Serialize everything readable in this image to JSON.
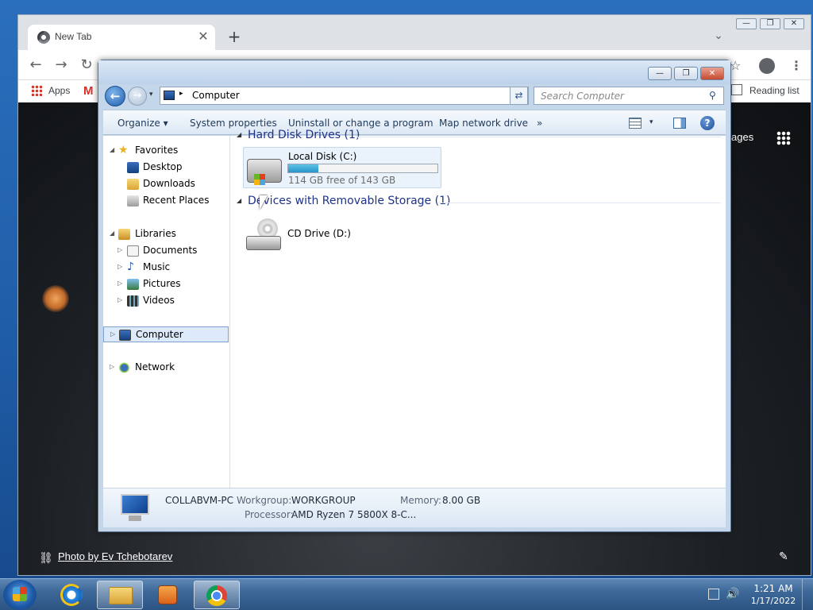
{
  "desktop": {
    "background_color": "#1f5ca6"
  },
  "chrome": {
    "tab_title": "New Tab",
    "tab_close": "✕",
    "new_tab": "+",
    "tab_dropdown": "⌄",
    "win_minimize": "—",
    "win_restore": "❐",
    "win_close": "✕",
    "nav_back": "←",
    "nav_forward": "→",
    "nav_reload": "↻",
    "star": "☆",
    "menu": "⋮",
    "bookmarks": {
      "apps_label": "Apps",
      "gmail": "M",
      "reading_list": "Reading list"
    },
    "ntp": {
      "images_link": "ages",
      "photo_credit": "Photo by Ev Tchebotarev",
      "link_icon": "⛓",
      "edit_icon": "✎"
    }
  },
  "explorer": {
    "win_minimize": "—",
    "win_restore": "❐",
    "win_close": "✕",
    "back": "←",
    "forward": "→",
    "recent_dd": "▾",
    "address": {
      "arrow": "▸",
      "path": "Computer",
      "dropdown": "▾",
      "refresh": "⇄"
    },
    "search": {
      "placeholder": "Search Computer",
      "icon": "⚲"
    },
    "commands": {
      "organize": "Organize ▾",
      "system_properties": "System properties",
      "uninstall": "Uninstall or change a program",
      "map_drive": "Map network drive",
      "more": "»",
      "view_dd": "▾",
      "help": "?"
    },
    "nav": {
      "favorites": "Favorites",
      "desktop": "Desktop",
      "downloads": "Downloads",
      "recent_places": "Recent Places",
      "libraries": "Libraries",
      "documents": "Documents",
      "music": "Music",
      "pictures": "Pictures",
      "videos": "Videos",
      "computer": "Computer",
      "network": "Network",
      "expanded": "◢",
      "collapsed": "▷"
    },
    "groups": {
      "hard_disk": "Hard Disk Drives (1)",
      "removable": "Devices with Removable Storage (1)",
      "tri": "◢"
    },
    "local_disk": {
      "name": "Local Disk (C:)",
      "free_text": "114 GB free of 143 GB",
      "used_fraction": 0.2,
      "bar_color": "#2a94c8"
    },
    "cd_drive": {
      "name": "CD Drive (D:)"
    },
    "details": {
      "computer_name": "COLLABVM-PC",
      "workgroup_label": "Workgroup:",
      "workgroup_value": "WORKGROUP",
      "memory_label": "Memory:",
      "memory_value": "8.00 GB",
      "processor_label": "Processor:",
      "processor_value": "AMD Ryzen 7 5800X 8-C..."
    }
  },
  "taskbar": {
    "clock_time": "1:21 AM",
    "clock_date": "1/17/2022",
    "volume_icon": "🔊"
  }
}
